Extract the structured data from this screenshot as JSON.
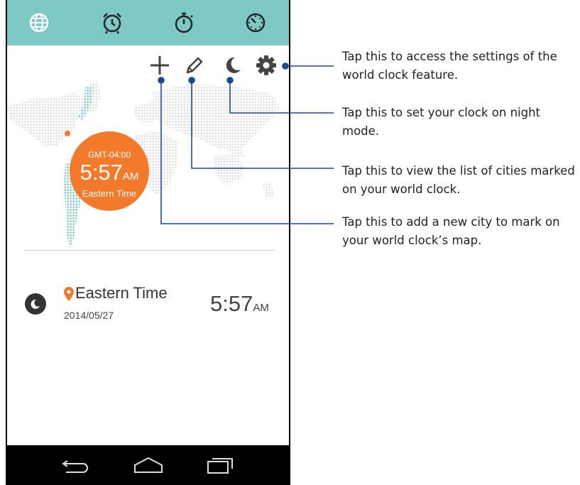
{
  "tabs": [
    {
      "name": "world-clock",
      "icon": "globe-icon"
    },
    {
      "name": "alarm",
      "icon": "alarm-clock-icon"
    },
    {
      "name": "stopwatch",
      "icon": "stopwatch-icon"
    },
    {
      "name": "timer",
      "icon": "timer-icon"
    }
  ],
  "toolbar": {
    "add_icon": "plus-icon",
    "edit_icon": "pencil-icon",
    "night_icon": "moon-icon",
    "settings_icon": "gear-icon"
  },
  "bubble": {
    "gmt": "GMT-04:00",
    "time": "5:57",
    "ampm": "AM",
    "zone": "Eastern Time"
  },
  "city": {
    "name": "Eastern Time",
    "date": "2014/05/27",
    "time": "5:57",
    "ampm": "AM"
  },
  "callouts": {
    "settings": "Tap this to access the settings of the world clock feature.",
    "night": "Tap this to set your clock on night mode.",
    "edit": "Tap this to view the list of cities marked on your world clock.",
    "add": "Tap this to add a new city to mark on your world clock’s map."
  },
  "colors": {
    "tabbar": "#7ec9c5",
    "accent": "#f37a2b",
    "callout_line": "#1a4b8c",
    "map_dots": "#d9d9d9",
    "highlight_dots": "#5cc2bd"
  }
}
